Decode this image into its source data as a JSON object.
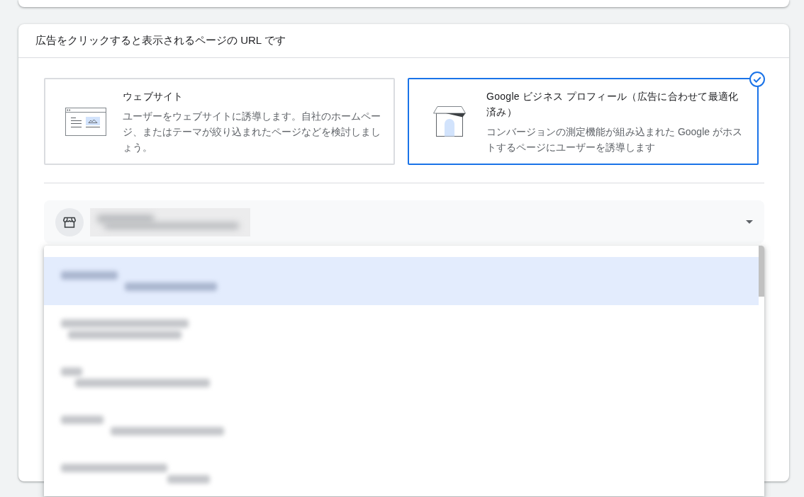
{
  "url_section": {
    "title": "広告をクリックすると表示されるページの URL です"
  },
  "options": [
    {
      "kind": "website",
      "title": "ウェブサイト",
      "description": "ユーザーをウェブサイトに誘導します。自社のホームページ、またはテーマが絞り込まれたページなどを検討しましょう。",
      "selected": false
    },
    {
      "kind": "business_profile",
      "title": "Google ビジネス プロフィール（広告に合わせて最適化済み）",
      "description": "コンバージョンの測定機能が組み込まれた Google がホストするページにユーザーを誘導します",
      "selected": true
    }
  ],
  "profile_select": {
    "expanded": true,
    "options": [
      {
        "selected": true
      },
      {
        "selected": false
      },
      {
        "selected": false
      },
      {
        "selected": false
      },
      {
        "selected": false
      }
    ]
  }
}
